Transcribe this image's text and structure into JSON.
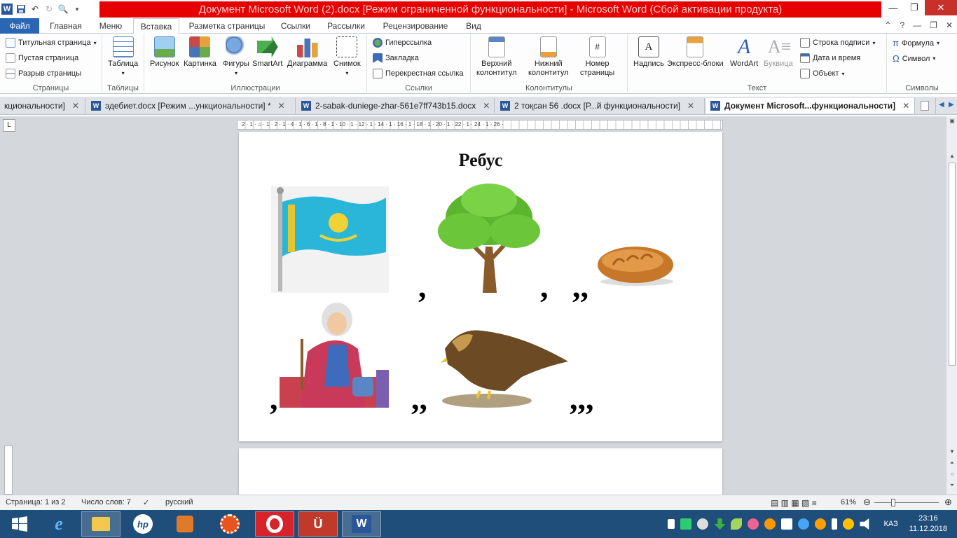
{
  "window": {
    "title": "Документ Microsoft Word (2).docx [Режим ограниченной функциональности]  -  Microsoft Word (Сбой активации продукта)",
    "app_icon_letter": "W"
  },
  "ribbon_tabs": [
    "Файл",
    "Главная",
    "Меню",
    "Вставка",
    "Разметка страницы",
    "Ссылки",
    "Рассылки",
    "Рецензирование",
    "Вид"
  ],
  "ribbon": {
    "pages": {
      "label": "Страницы",
      "items": [
        "Титульная страница",
        "Пустая страница",
        "Разрыв страницы"
      ]
    },
    "tables": {
      "label": "Таблицы",
      "button": "Таблица"
    },
    "illustrations": {
      "label": "Иллюстрации",
      "buttons": [
        "Рисунок",
        "Картинка",
        "Фигуры",
        "SmartArt",
        "Диаграмма",
        "Снимок"
      ]
    },
    "links": {
      "label": "Ссылки",
      "items": [
        "Гиперссылка",
        "Закладка",
        "Перекрестная ссылка"
      ]
    },
    "headers": {
      "label": "Колонтитулы",
      "buttons": [
        {
          "l1": "Верхний",
          "l2": "колонтитул"
        },
        {
          "l1": "Нижний",
          "l2": "колонтитул"
        },
        {
          "l1": "Номер",
          "l2": "страницы"
        }
      ]
    },
    "text": {
      "label": "Текст",
      "buttons": [
        "Надпись",
        "Экспресс-блоки",
        "WordArt",
        "Буквица"
      ],
      "items": [
        "Строка подписи",
        "Дата и время",
        "Объект"
      ]
    },
    "symbols": {
      "label": "Символы",
      "items": [
        "Формула",
        "Символ"
      ]
    }
  },
  "doc_tabs": [
    "кциональности]",
    "эдебиет.docx [Режим ...ункциональности]  *",
    "2-sabak-duniege-zhar-561e7ff743b15.docx",
    "2 тоқсан 56 .docx [Р...й функциональности]",
    "Документ Microsoft...функциональности]"
  ],
  "ruler": {
    "numbers": "2 · 1 · ⌂ · 1 · 2 · 1 · 4 · 1 · 6 · 1 · 8 · 1 · 10 · 1 · 12 · 1 · 14 · 1 · 16 · 1 · 18 · 1 · 20 · 1 · 22 · 1 · 24 · 1 · 26 ·"
  },
  "document": {
    "title": "Ребус",
    "punct": {
      "c1": ",",
      "c2": ",",
      "c3": ",,",
      "c4": ",",
      "c5": ",,",
      "c6": ",,,"
    }
  },
  "status": {
    "page": "Страница: 1 из 2",
    "words": "Число слов: 7",
    "language": "русский",
    "zoom": "61%"
  },
  "taskbar": {
    "lang": "КАЗ",
    "time": "23:16",
    "date": "11.12.2018"
  },
  "colors": {
    "file_tab": "#2b66b5",
    "title_bar_red": "#e60000",
    "taskbar": "#1f4e7a",
    "word_blue": "#2b579a"
  }
}
